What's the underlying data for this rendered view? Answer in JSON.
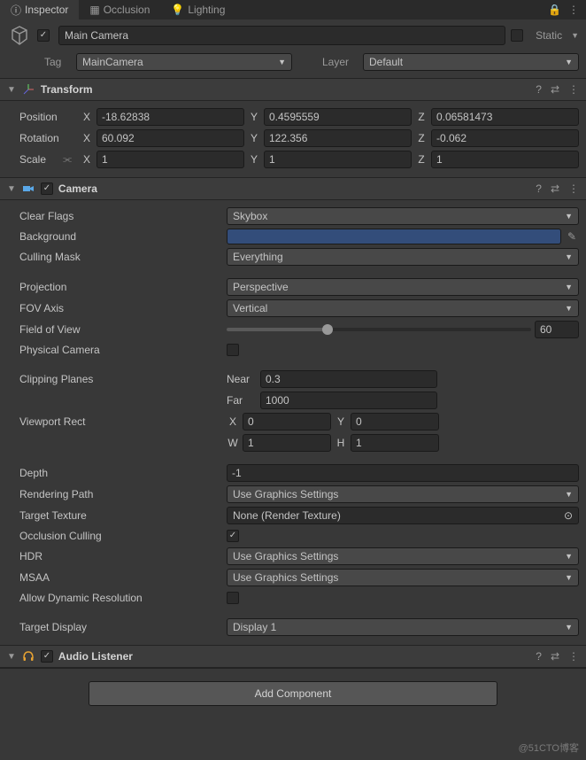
{
  "tabs": {
    "inspector": "Inspector",
    "occlusion": "Occlusion",
    "lighting": "Lighting"
  },
  "header": {
    "name": "Main Camera",
    "static_label": "Static"
  },
  "tag_layer": {
    "tag_label": "Tag",
    "tag_value": "MainCamera",
    "layer_label": "Layer",
    "layer_value": "Default"
  },
  "transform": {
    "title": "Transform",
    "position_label": "Position",
    "position": {
      "x": "-18.62838",
      "y": "0.4595559",
      "z": "0.06581473"
    },
    "rotation_label": "Rotation",
    "rotation": {
      "x": "60.092",
      "y": "122.356",
      "z": "-0.062"
    },
    "scale_label": "Scale",
    "scale": {
      "x": "1",
      "y": "1",
      "z": "1"
    },
    "axis": {
      "x": "X",
      "y": "Y",
      "z": "Z"
    }
  },
  "camera": {
    "title": "Camera",
    "clear_flags_label": "Clear Flags",
    "clear_flags": "Skybox",
    "background_label": "Background",
    "culling_mask_label": "Culling Mask",
    "culling_mask": "Everything",
    "projection_label": "Projection",
    "projection": "Perspective",
    "fov_axis_label": "FOV Axis",
    "fov_axis": "Vertical",
    "fov_label": "Field of View",
    "fov": "60",
    "physical_camera_label": "Physical Camera",
    "clipping_label": "Clipping Planes",
    "near_label": "Near",
    "near": "0.3",
    "far_label": "Far",
    "far": "1000",
    "viewport_label": "Viewport Rect",
    "viewport": {
      "x": "0",
      "y": "0",
      "w": "1",
      "h": "1"
    },
    "vlabels": {
      "x": "X",
      "y": "Y",
      "w": "W",
      "h": "H"
    },
    "depth_label": "Depth",
    "depth": "-1",
    "rendering_path_label": "Rendering Path",
    "rendering_path": "Use Graphics Settings",
    "target_texture_label": "Target Texture",
    "target_texture": "None (Render Texture)",
    "occlusion_label": "Occlusion Culling",
    "hdr_label": "HDR",
    "hdr": "Use Graphics Settings",
    "msaa_label": "MSAA",
    "msaa": "Use Graphics Settings",
    "dynres_label": "Allow Dynamic Resolution",
    "target_display_label": "Target Display",
    "target_display": "Display 1"
  },
  "audio": {
    "title": "Audio Listener"
  },
  "add_component": "Add Component",
  "watermark": "@51CTO博客"
}
